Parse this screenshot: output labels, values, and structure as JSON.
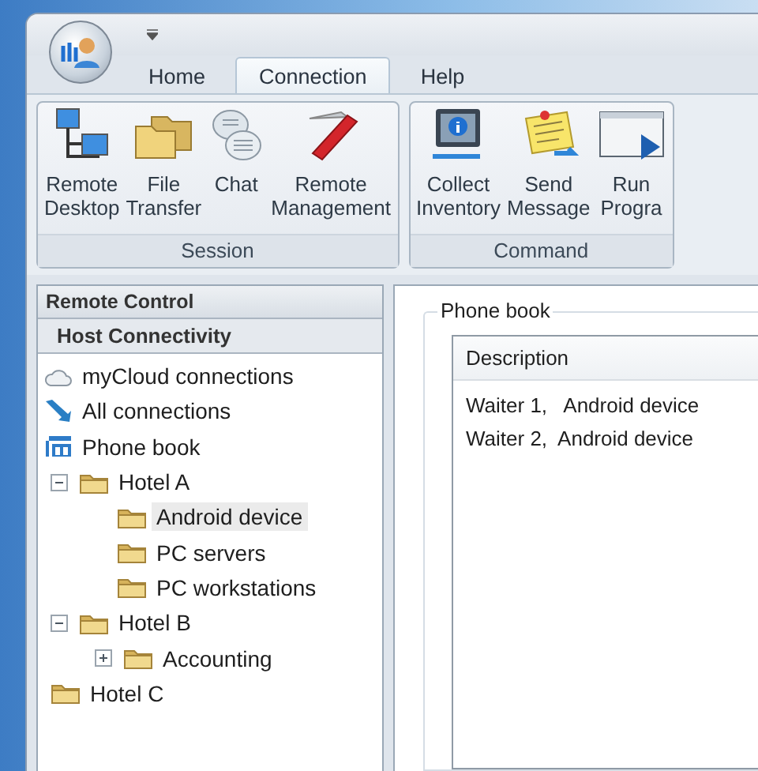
{
  "ribbon": {
    "tabs": [
      {
        "label": "Home",
        "selected": false
      },
      {
        "label": "Connection",
        "selected": true
      },
      {
        "label": "Help",
        "selected": false
      }
    ],
    "groups": [
      {
        "title": "Session",
        "buttons": [
          {
            "kind": "desktop",
            "lines": [
              "Remote",
              "Desktop"
            ]
          },
          {
            "kind": "files",
            "lines": [
              "File",
              "Transfer"
            ]
          },
          {
            "kind": "chat",
            "lines": [
              "Chat"
            ]
          },
          {
            "kind": "tool",
            "lines": [
              "Remote",
              "Management"
            ]
          }
        ]
      },
      {
        "title": "Command",
        "buttons": [
          {
            "kind": "inventory",
            "lines": [
              "Collect",
              "Inventory"
            ]
          },
          {
            "kind": "message",
            "lines": [
              "Send",
              "Message"
            ]
          },
          {
            "kind": "program",
            "lines": [
              "Run",
              "Progra"
            ]
          }
        ]
      }
    ]
  },
  "sidebar": {
    "title": "Remote Control",
    "section": "Host Connectivity",
    "tree": [
      {
        "label": "myCloud connections",
        "kind": "cloud",
        "selected": false
      },
      {
        "label": "All connections",
        "kind": "arrow",
        "selected": false
      },
      {
        "label": "Phone book",
        "kind": "phonebook",
        "selected": false,
        "children": [
          {
            "label": "Hotel A",
            "kind": "folder",
            "selected": false,
            "expanded": true,
            "children": [
              {
                "label": "Android device",
                "kind": "folder",
                "selected": true
              },
              {
                "label": "PC servers",
                "kind": "folder",
                "selected": false
              },
              {
                "label": "PC workstations",
                "kind": "folder",
                "selected": false
              }
            ]
          },
          {
            "label": "Hotel B",
            "kind": "folder",
            "selected": false,
            "expanded": true,
            "children": [
              {
                "label": "Accounting",
                "kind": "folder",
                "selected": false,
                "expanded": false
              }
            ]
          },
          {
            "label": "Hotel C",
            "kind": "folder",
            "selected": false
          }
        ]
      }
    ]
  },
  "content": {
    "group_title": "Phone book",
    "columns": [
      "Description"
    ],
    "rows": [
      "Waiter 1,   Android device",
      "Waiter 2,  Android device"
    ]
  }
}
